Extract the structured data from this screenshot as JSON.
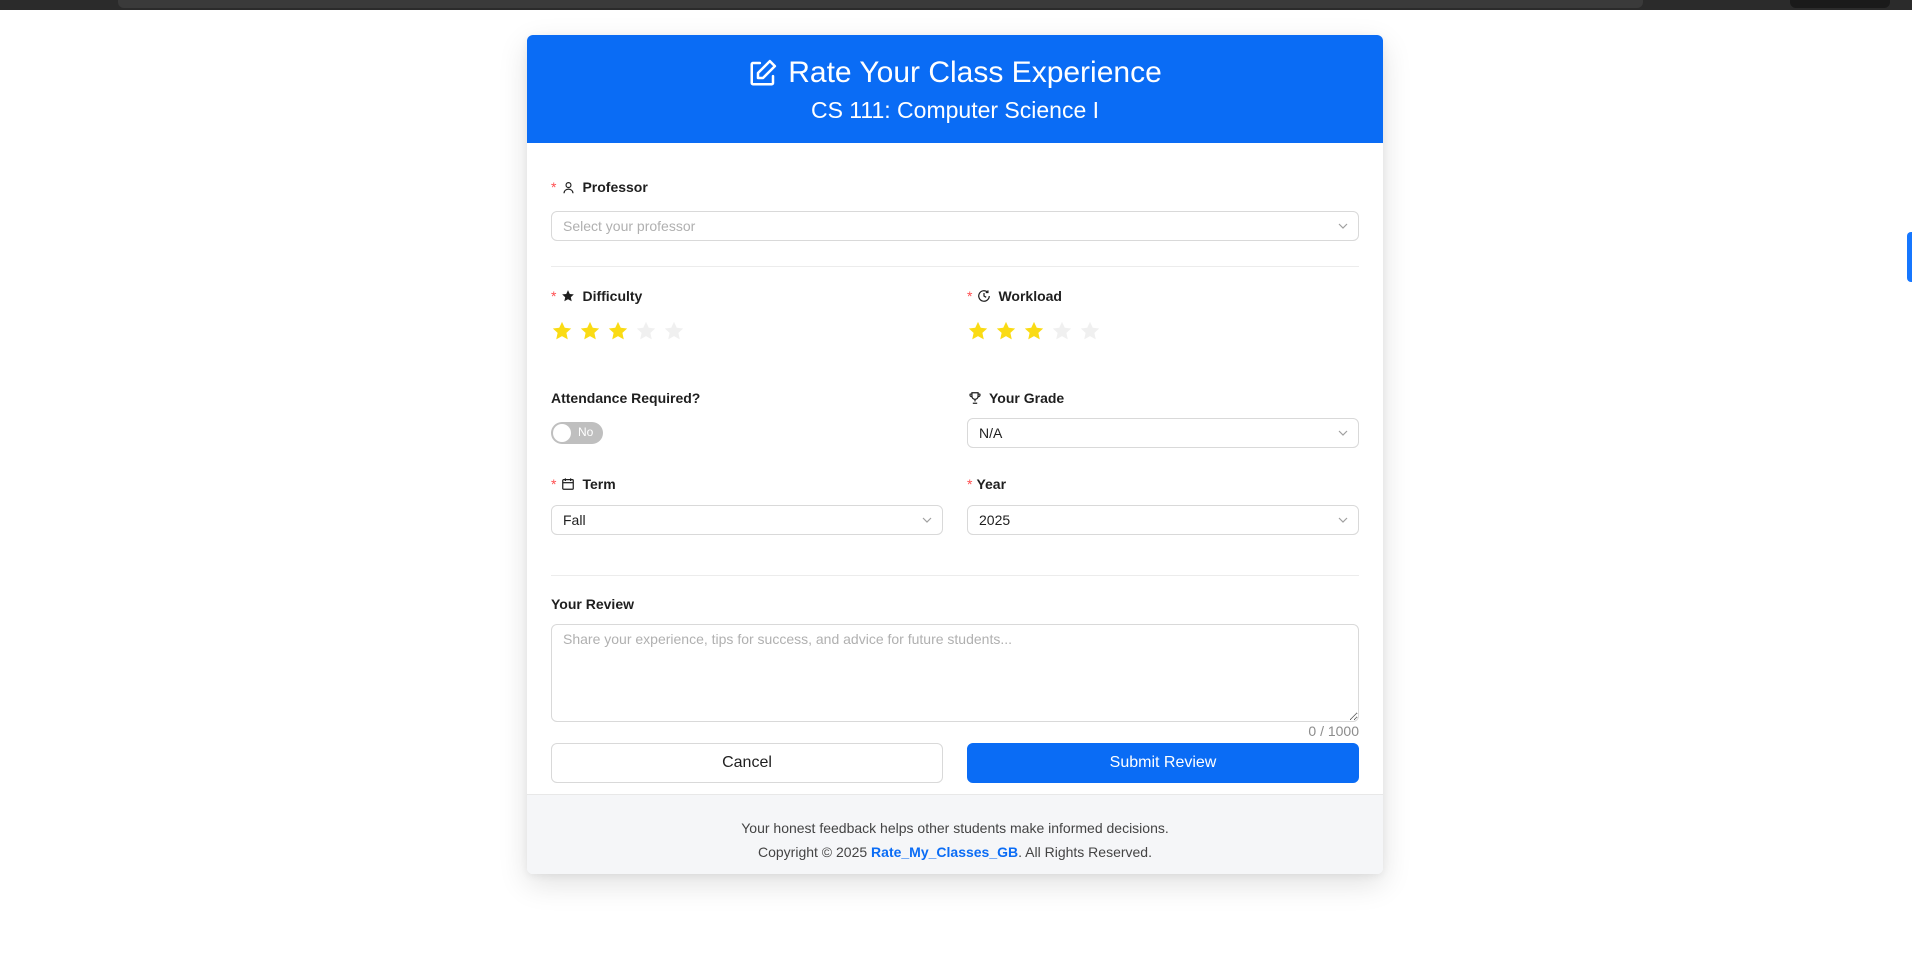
{
  "header": {
    "title": "Rate Your Class Experience",
    "subtitle": "CS 111: Computer Science I",
    "title_icon": "edit-icon"
  },
  "form": {
    "professor": {
      "label": "Professor",
      "required": true,
      "icon": "user-icon",
      "placeholder": "Select your professor",
      "value": ""
    },
    "difficulty": {
      "label": "Difficulty",
      "required": true,
      "icon": "star-icon",
      "rating": 3,
      "max": 5
    },
    "workload": {
      "label": "Workload",
      "required": true,
      "icon": "clock-icon",
      "rating": 3,
      "max": 5
    },
    "attendance": {
      "label": "Attendance Required?",
      "toggle_text": "No",
      "value": false
    },
    "grade": {
      "label": "Your Grade",
      "icon": "trophy-icon",
      "value": "N/A"
    },
    "term": {
      "label": "Term",
      "required": true,
      "icon": "calendar-icon",
      "value": "Fall"
    },
    "year": {
      "label": "Year",
      "required": true,
      "value": "2025"
    },
    "review": {
      "label": "Your Review",
      "placeholder": "Share your experience, tips for success, and advice for future students...",
      "value": "",
      "counter": "0 / 1000"
    }
  },
  "buttons": {
    "cancel": "Cancel",
    "submit": "Submit Review"
  },
  "footer": {
    "line1": "Your honest feedback helps other students make informed decisions.",
    "copyright_prefix": "Copyright © 2025 ",
    "brand": "Rate_My_Classes_GB",
    "copyright_suffix": ". All Rights Reserved."
  },
  "colors": {
    "primary": "#0a6cf5",
    "star_filled": "#fadb14",
    "star_empty": "#f0f0f0",
    "required": "#ff4d4f"
  }
}
